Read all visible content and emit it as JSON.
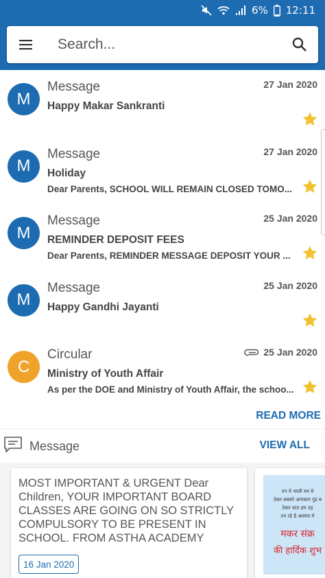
{
  "status_bar": {
    "battery": "6%",
    "time": "12:11",
    "icons": [
      "mute-icon",
      "wifi-icon",
      "signal-icon",
      "battery-icon"
    ]
  },
  "search": {
    "placeholder": "Search...",
    "menu_icon": "hamburger-menu-icon",
    "search_icon": "search-icon"
  },
  "items": [
    {
      "avatar": "M",
      "avatar_color": "#1d6bb0",
      "type": "Message",
      "date": "27 Jan 2020",
      "subject": "Happy Makar Sankranti",
      "preview": "",
      "attachment": false,
      "starred": true
    },
    {
      "avatar": "M",
      "avatar_color": "#1d6bb0",
      "type": "Message",
      "date": "27 Jan 2020",
      "subject": "Holiday",
      "preview": "Dear Parents, SCHOOL WILL REMAIN CLOSED TOMO...",
      "attachment": false,
      "starred": true
    },
    {
      "avatar": "M",
      "avatar_color": "#1d6bb0",
      "type": "Message",
      "date": "25 Jan 2020",
      "subject": "REMINDER DEPOSIT FEES",
      "preview": "Dear Parents, REMINDER MESSAGE DEPOSIT YOUR ...",
      "attachment": false,
      "starred": true
    },
    {
      "avatar": "M",
      "avatar_color": "#1d6bb0",
      "type": "Message",
      "date": "25 Jan 2020",
      "subject": "Happy Gandhi Jayanti",
      "preview": "",
      "attachment": false,
      "starred": true
    },
    {
      "avatar": "C",
      "avatar_color": "#f0a32b",
      "type": "Circular",
      "date": "25 Jan 2020",
      "subject": "Ministry of Youth Affair",
      "preview": "As per the DOE and Ministry of Youth Affair, the schoo...",
      "attachment": true,
      "starred": true
    }
  ],
  "read_more": "READ MORE",
  "message_section": {
    "title": "Message",
    "view_all": "VIEW ALL",
    "cards": [
      {
        "text": "MOST IMPORTANT & URGENT Dear Children, YOUR IMPORTANT BOARD CLASSES ARE GOING ON SO STRICTLY COMPULSORY TO BE PRESENT IN SCHOOL. FROM ASTHA ACADEMY",
        "date": "16 Jan 2020"
      }
    ],
    "poster": {
      "lines": [
        "तन मे भरती मन मे",
        "देकर सबको आपसान गुड ब",
        "ठेकर सात हम उड़",
        "तन रहे है आसमा मे"
      ],
      "title_line1": "मकर संक्र",
      "title_line2": "की हार्दिक शुभ"
    }
  },
  "colors": {
    "primary": "#1d6bb0",
    "star": "#f2c12e",
    "circular_avatar": "#f0a32b"
  }
}
